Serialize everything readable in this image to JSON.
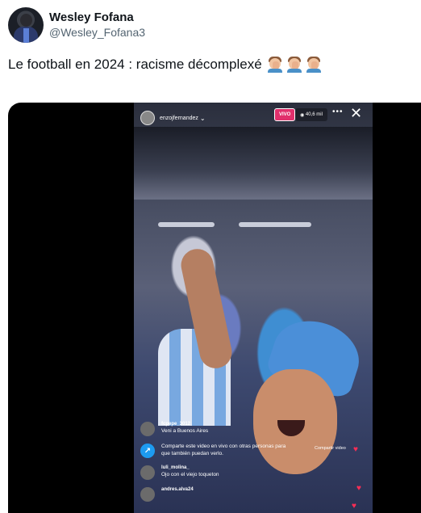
{
  "author": {
    "display_name": "Wesley Fofana",
    "handle": "@Wesley_Fofana3"
  },
  "tweet": {
    "text": "Le football en 2024 : racisme décomplexé",
    "emoji_icon": "man-facepalming-icon",
    "emoji_count": 3
  },
  "video": {
    "ig_username": "enzojfernandez",
    "live_label": "VIVO",
    "viewer_count": "40,6 mil",
    "comments": [
      {
        "user": "fcpepe_3012",
        "text": "Veni a Buenos Aires"
      },
      {
        "user": "",
        "text": "Comparte este video en vivo con otras personas para que también puedan verlo.",
        "action": "Compartir video"
      },
      {
        "user": "luli_molina_",
        "text": "Ojo con el viejo toqueton"
      },
      {
        "user": "andres.alva24",
        "text": ""
      }
    ]
  },
  "colors": {
    "live_badge": "#e1306c",
    "heart": "#ff2d55",
    "share_icon": "#1d9bf0"
  }
}
